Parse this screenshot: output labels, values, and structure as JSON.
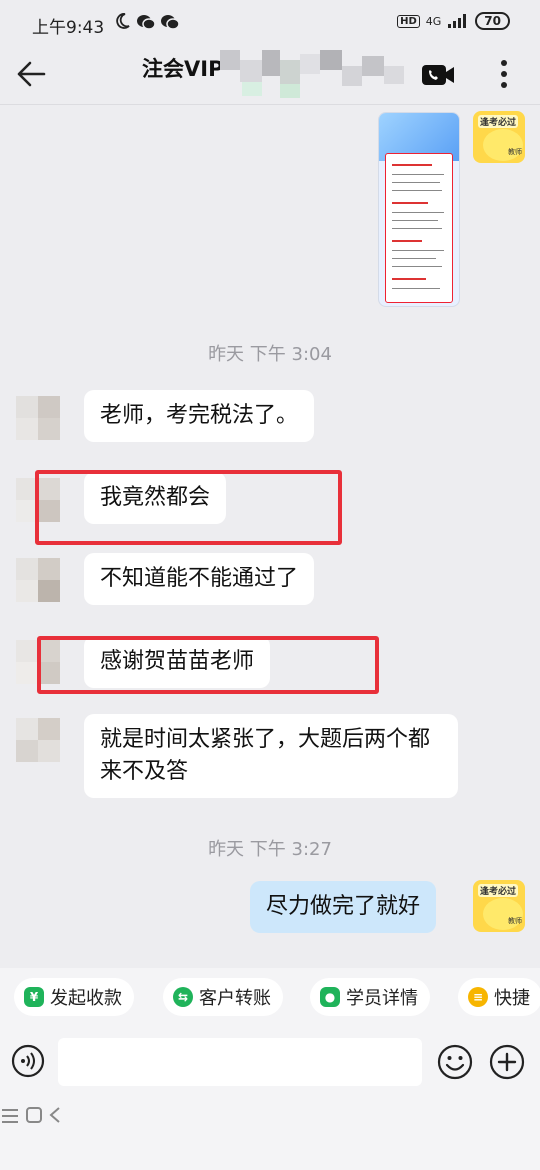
{
  "status_bar": {
    "time": "上午9:43",
    "hd_badge": "HD",
    "network": "4G",
    "battery": "70"
  },
  "header": {
    "title": "注会VIP"
  },
  "chat": {
    "time_label_1": "昨天   下午 3:04",
    "messages_1": [
      "老师，考完税法了。",
      "我竟然都会",
      "不知道能不能通过了",
      "感谢贺苗苗老师",
      "就是时间太紧张了，大题后两个都来不及答"
    ],
    "time_label_2": "昨天   下午 3:27",
    "reply": "尽力做完了就好",
    "avatar_tag": "逢考必过",
    "avatar_sub": "教师"
  },
  "quick_actions": [
    {
      "label": "发起收款",
      "icon": "yuan-icon",
      "color": "#1fb35a",
      "glyph": "¥"
    },
    {
      "label": "客户转账",
      "icon": "transfer-icon",
      "color": "#1fb35a",
      "glyph": "⇆"
    },
    {
      "label": "学员详情",
      "icon": "user-icon",
      "color": "#1fb35a",
      "glyph": "●"
    },
    {
      "label": "快捷",
      "icon": "shortcut-icon",
      "color": "#f7b500",
      "glyph": "≡"
    }
  ],
  "colors": {
    "bubble_self": "#cde7fb",
    "highlight_box": "#e8303a",
    "background": "#ededf0"
  }
}
